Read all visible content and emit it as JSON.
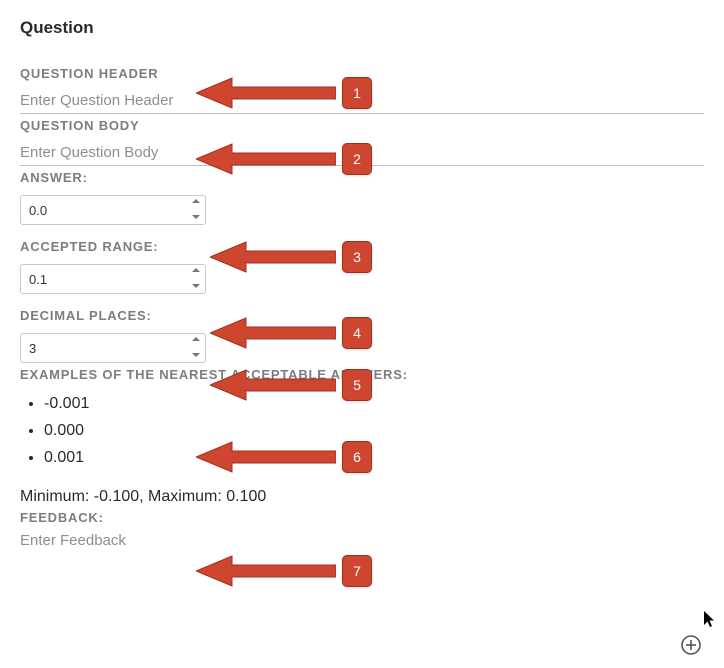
{
  "title": "Question",
  "questionHeader": {
    "label": "QUESTION HEADER",
    "placeholder": "Enter Question Header"
  },
  "questionBody": {
    "label": "QUESTION BODY",
    "placeholder": "Enter Question Body"
  },
  "answer": {
    "label": "ANSWER:",
    "value": "0.0"
  },
  "acceptedRange": {
    "label": "ACCEPTED RANGE:",
    "value": "0.1"
  },
  "decimalPlaces": {
    "label": "DECIMAL PLACES:",
    "value": "3"
  },
  "examples": {
    "label": "EXAMPLES OF THE NEAREST ACCEPTABLE ANSWERS:",
    "items": [
      "-0.001",
      "0.000",
      "0.001"
    ]
  },
  "minmax": "Minimum: -0.100, Maximum: 0.100",
  "feedback": {
    "label": "FEEDBACK:",
    "placeholder": "Enter Feedback"
  },
  "callouts": [
    "1",
    "2",
    "3",
    "4",
    "5",
    "6",
    "7"
  ],
  "colors": {
    "accent": "#cf4630"
  }
}
